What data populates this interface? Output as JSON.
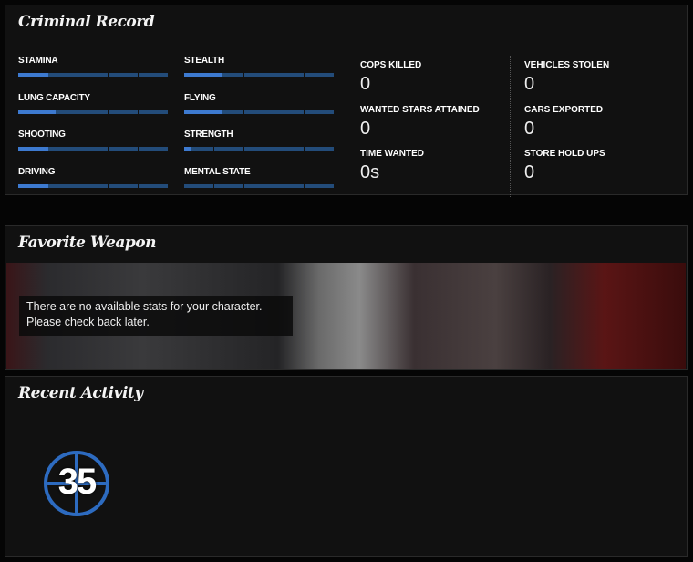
{
  "criminal_record": {
    "title": "Criminal Record",
    "skills": [
      {
        "label": "STAMINA",
        "value": 0.2
      },
      {
        "label": "STEALTH",
        "value": 0.25
      },
      {
        "label": "LUNG CAPACITY",
        "value": 0.25
      },
      {
        "label": "FLYING",
        "value": 0.25
      },
      {
        "label": "SHOOTING",
        "value": 0.2
      },
      {
        "label": "STRENGTH",
        "value": 0.05
      },
      {
        "label": "DRIVING",
        "value": 0.2
      },
      {
        "label": "MENTAL STATE",
        "value": 0
      }
    ],
    "stats": [
      {
        "label": "COPS KILLED",
        "value": "0"
      },
      {
        "label": "VEHICLES STOLEN",
        "value": "0"
      },
      {
        "label": "WANTED STARS ATTAINED",
        "value": "0"
      },
      {
        "label": "CARS EXPORTED",
        "value": "0"
      },
      {
        "label": "TIME WANTED",
        "value": "0s"
      },
      {
        "label": "STORE HOLD UPS",
        "value": "0"
      }
    ]
  },
  "favorite_weapon": {
    "title": "Favorite Weapon",
    "message_line1": "There are no available stats for your character.",
    "message_line2": "Please check back later."
  },
  "recent_activity": {
    "title": "Recent Activity",
    "rank": "35"
  },
  "colors": {
    "bar_fill": "#3d7ad0",
    "bar_empty": "#234c7a",
    "rank_badge": "#2d6bc0"
  }
}
